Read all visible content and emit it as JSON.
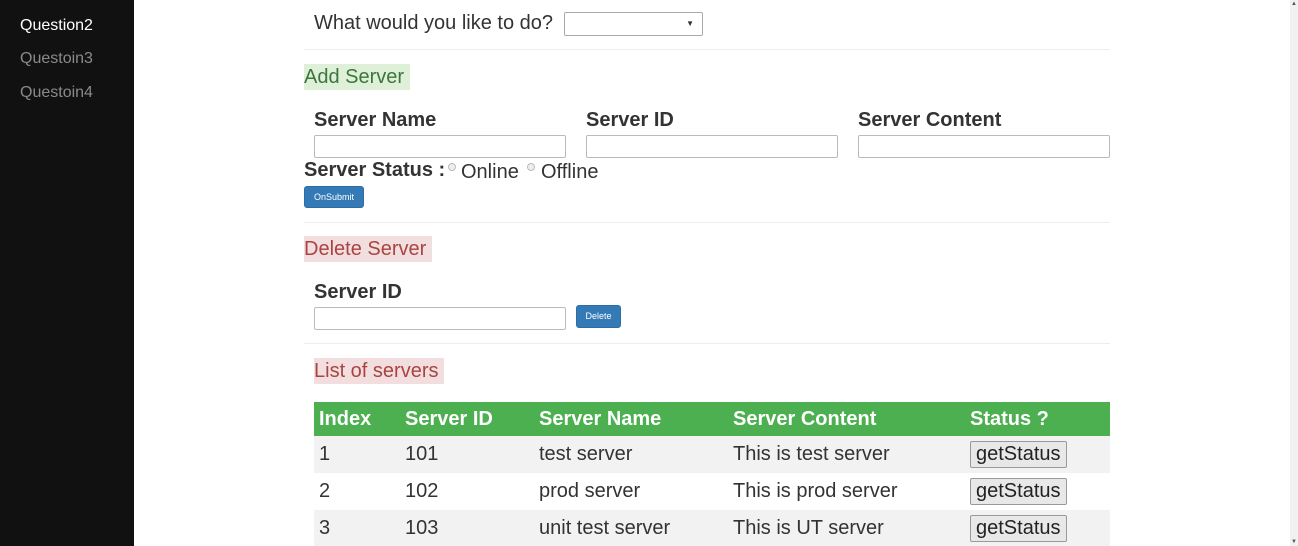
{
  "sidebar": {
    "items": [
      {
        "label": "Question2",
        "active": true
      },
      {
        "label": "Questoin3",
        "active": false
      },
      {
        "label": "Questoin4",
        "active": false
      }
    ]
  },
  "action": {
    "prompt": "What would you like to do?",
    "selected": ""
  },
  "add_server": {
    "title": "Add Server",
    "name_label": "Server Name",
    "id_label": "Server ID",
    "content_label": "Server Content",
    "status_label": "Server Status :",
    "online_label": "Online",
    "offline_label": "Offline",
    "submit_label": "OnSubmit"
  },
  "delete_server": {
    "title": "Delete Server",
    "id_label": "Server ID",
    "delete_label": "Delete"
  },
  "server_list": {
    "title": "List of servers",
    "columns": [
      "Index",
      "Server ID",
      "Server Name",
      "Server Content",
      "Status ?"
    ],
    "rows": [
      {
        "index": "1",
        "id": "101",
        "name": "test server",
        "content": "This is test server",
        "action": "getStatus"
      },
      {
        "index": "2",
        "id": "102",
        "name": "prod server",
        "content": "This is prod server",
        "action": "getStatus"
      },
      {
        "index": "3",
        "id": "103",
        "name": "unit test server",
        "content": "This is UT server",
        "action": "getStatus"
      }
    ]
  },
  "colors": {
    "sidebar_bg": "#111111",
    "table_header": "#4caf50",
    "primary_button": "#337ab7",
    "success_bg": "#dff0d8",
    "danger_bg": "#f2dede"
  }
}
